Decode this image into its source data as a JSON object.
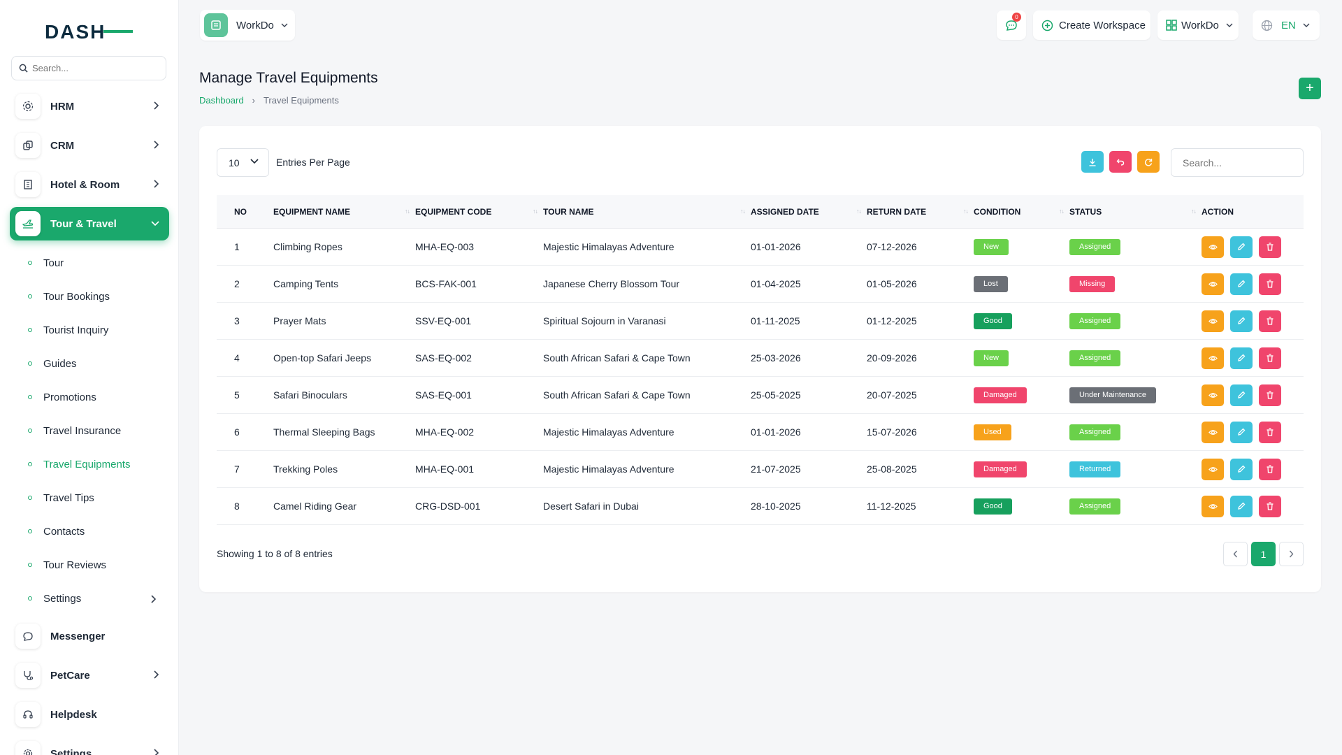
{
  "brand": {
    "logo_text": "DASH",
    "accent": "#1aa86c"
  },
  "sidebar": {
    "search_placeholder": "Search...",
    "items": [
      {
        "label": "HRM",
        "has_children": true
      },
      {
        "label": "CRM",
        "has_children": true
      },
      {
        "label": "Hotel & Room",
        "has_children": true
      },
      {
        "label": "Tour & Travel",
        "has_children": true,
        "active": true
      }
    ],
    "sub_items": [
      {
        "label": "Tour"
      },
      {
        "label": "Tour Bookings"
      },
      {
        "label": "Tourist Inquiry"
      },
      {
        "label": "Guides"
      },
      {
        "label": "Promotions"
      },
      {
        "label": "Travel Insurance"
      },
      {
        "label": "Travel Equipments",
        "current": true
      },
      {
        "label": "Travel Tips"
      },
      {
        "label": "Contacts"
      },
      {
        "label": "Tour Reviews"
      },
      {
        "label": "Settings",
        "has_children": true
      }
    ],
    "bottom_items": [
      {
        "label": "Messenger"
      },
      {
        "label": "PetCare",
        "has_children": true
      },
      {
        "label": "Helpdesk"
      },
      {
        "label": "Settings",
        "has_children": true
      }
    ]
  },
  "topbar": {
    "workspace_label": "WorkDo",
    "message_count": "0",
    "create_workspace_label": "Create Workspace",
    "workdo_label": "WorkDo",
    "language_label": "EN"
  },
  "page": {
    "title": "Manage Travel Equipments",
    "breadcrumb": [
      "Dashboard",
      "Travel Equipments"
    ],
    "add_label": "+"
  },
  "table_controls": {
    "entries_value": "10",
    "entries_label": "Entries Per Page",
    "search_placeholder": "Search..."
  },
  "table": {
    "columns": [
      "NO",
      "EQUIPMENT NAME",
      "EQUIPMENT CODE",
      "TOUR NAME",
      "ASSIGNED DATE",
      "RETURN DATE",
      "CONDITION",
      "STATUS",
      "ACTION"
    ],
    "rows": [
      {
        "no": "1",
        "name": "Climbing Ropes",
        "code": "MHA-EQ-003",
        "tour": "Majestic Himalayas Adventure",
        "assigned": "01-01-2026",
        "returned": "07-12-2026",
        "condition": "New",
        "status": "Assigned"
      },
      {
        "no": "2",
        "name": "Camping Tents",
        "code": "BCS-FAK-001",
        "tour": "Japanese Cherry Blossom Tour",
        "assigned": "01-04-2025",
        "returned": "01-05-2026",
        "condition": "Lost",
        "status": "Missing"
      },
      {
        "no": "3",
        "name": "Prayer Mats",
        "code": "SSV-EQ-001",
        "tour": "Spiritual Sojourn in Varanasi",
        "assigned": "01-11-2025",
        "returned": "01-12-2025",
        "condition": "Good",
        "status": "Assigned"
      },
      {
        "no": "4",
        "name": "Open-top Safari Jeeps",
        "code": "SAS-EQ-002",
        "tour": "South African Safari & Cape Town",
        "assigned": "25-03-2026",
        "returned": "20-09-2026",
        "condition": "New",
        "status": "Assigned"
      },
      {
        "no": "5",
        "name": "Safari Binoculars",
        "code": "SAS-EQ-001",
        "tour": "South African Safari & Cape Town",
        "assigned": "25-05-2025",
        "returned": "20-07-2025",
        "condition": "Damaged",
        "status": "Under Maintenance"
      },
      {
        "no": "6",
        "name": "Thermal Sleeping Bags",
        "code": "MHA-EQ-002",
        "tour": "Majestic Himalayas Adventure",
        "assigned": "01-01-2026",
        "returned": "15-07-2026",
        "condition": "Used",
        "status": "Assigned"
      },
      {
        "no": "7",
        "name": "Trekking Poles",
        "code": "MHA-EQ-001",
        "tour": "Majestic Himalayas Adventure",
        "assigned": "21-07-2025",
        "returned": "25-08-2025",
        "condition": "Damaged",
        "status": "Returned"
      },
      {
        "no": "8",
        "name": "Camel Riding Gear",
        "code": "CRG-DSD-001",
        "tour": "Desert Safari in Dubai",
        "assigned": "28-10-2025",
        "returned": "11-12-2025",
        "condition": "Good",
        "status": "Assigned"
      }
    ]
  },
  "badge_colors": {
    "New": "#6ad14a",
    "Lost": "#6b6f76",
    "Good": "#17a05d",
    "Damaged": "#f0456c",
    "Used": "#f7a21b",
    "Assigned": "#6ad14a",
    "Missing": "#f0456c",
    "Under Maintenance": "#6b6f76",
    "Returned": "#3ec3dc"
  },
  "footer": {
    "showing_text": "Showing 1 to 8 of 8 entries",
    "current_page": "1"
  }
}
